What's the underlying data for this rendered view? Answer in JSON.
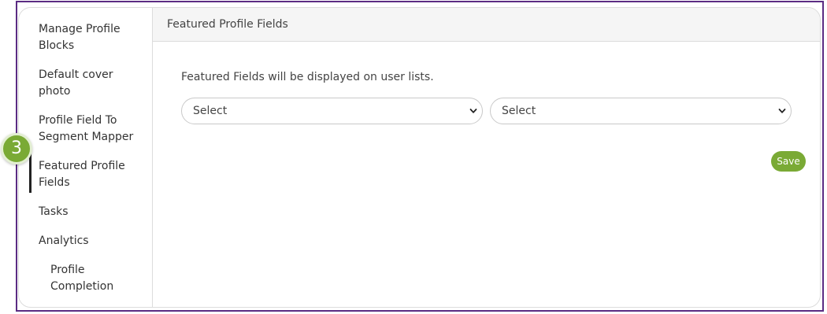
{
  "sidebar": {
    "items": [
      {
        "label": "Manage Profile Blocks"
      },
      {
        "label": "Default cover photo"
      },
      {
        "label": "Profile Field To Segment Mapper"
      },
      {
        "label": "Featured Profile Fields"
      },
      {
        "label": "Tasks"
      },
      {
        "label": "Analytics"
      },
      {
        "label": "Profile Completion"
      }
    ],
    "active_index": 3
  },
  "main": {
    "header_title": "Featured Profile Fields",
    "description": "Featured Fields will be displayed on user lists.",
    "selects": [
      {
        "value": "Select"
      },
      {
        "value": "Select"
      }
    ],
    "save_label": "Save"
  },
  "step_badge": {
    "number": "3"
  },
  "colors": {
    "accent": "#7aaa35",
    "frame": "#5b2c83",
    "active_indicator": "#222222",
    "header_bg": "#f5f5f5"
  }
}
